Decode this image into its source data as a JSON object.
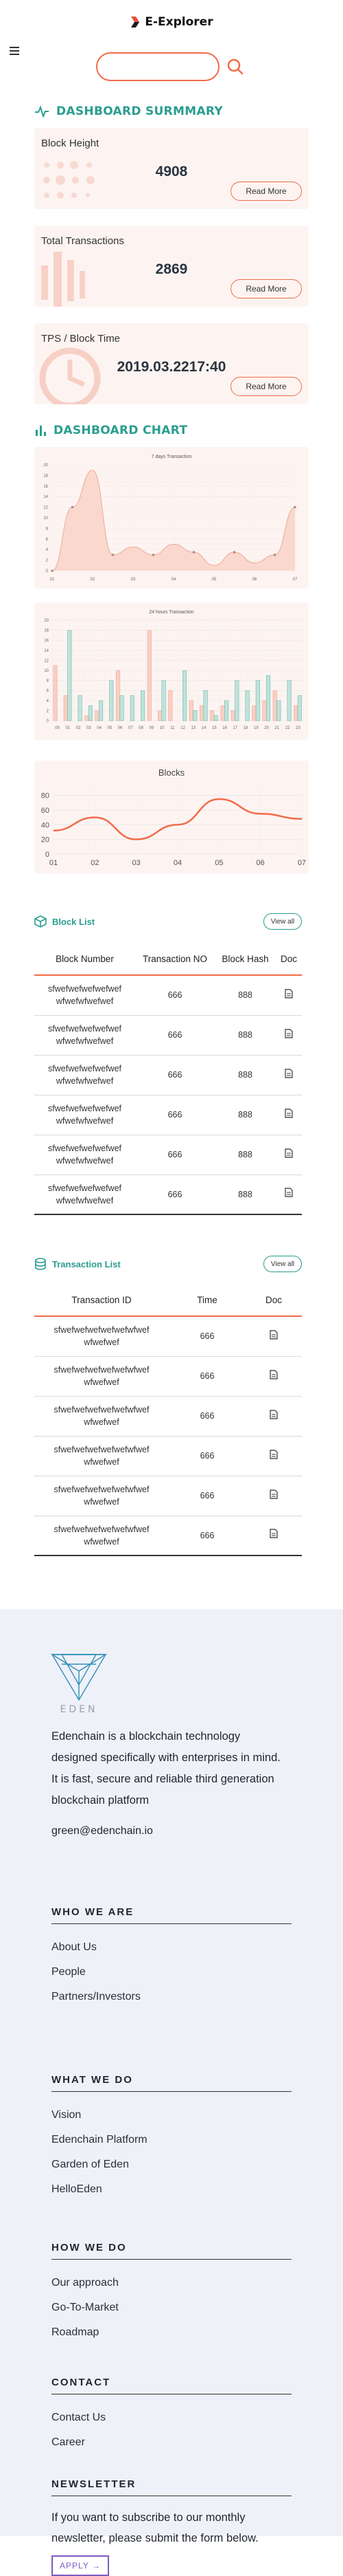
{
  "header": {
    "brand": "E-Explorer",
    "search_placeholder": ""
  },
  "summary": {
    "title": "DASHBOARD SURMMARY",
    "cards": [
      {
        "label": "Block Height",
        "value": "4908",
        "button": "Read More"
      },
      {
        "label": "Total Transactions",
        "value": "2869",
        "button": "Read More"
      },
      {
        "label": "TPS / Block Time",
        "value": "2019.03.2217:40",
        "button": "Read More"
      }
    ]
  },
  "charts_section": {
    "title": "DASHBOARD CHART"
  },
  "chart_data": [
    {
      "type": "area",
      "title": "7 days Transaction",
      "categories": [
        "01",
        "02",
        "03",
        "04",
        "05",
        "06",
        "07"
      ],
      "x": [
        0,
        1,
        2,
        3,
        4,
        5,
        6,
        7,
        8,
        9,
        10,
        11,
        12
      ],
      "values": [
        0,
        12,
        19,
        3,
        4.5,
        3,
        5,
        3.5,
        1,
        3.5,
        1.5,
        3,
        12
      ],
      "ylim": [
        0,
        20
      ],
      "yticks": [
        "0",
        "2",
        "4",
        "6",
        "8",
        "10",
        "12",
        "14",
        "16",
        "18",
        "20"
      ]
    },
    {
      "type": "bar",
      "title": "24 hours Transaction",
      "categories": [
        "00",
        "01",
        "02",
        "03",
        "04",
        "05",
        "06",
        "07",
        "08",
        "09",
        "10",
        "11",
        "12",
        "13",
        "14",
        "15",
        "16",
        "17",
        "18",
        "19",
        "20",
        "21",
        "22",
        "23"
      ],
      "series": [
        {
          "name": "",
          "values": [
            11,
            5,
            0,
            1,
            2,
            0,
            10,
            0,
            0,
            18,
            2,
            6,
            0,
            4,
            3,
            2,
            3,
            2,
            0,
            3,
            4,
            6,
            0,
            3
          ]
        },
        {
          "name": "",
          "values": [
            0,
            18,
            5,
            3,
            4,
            8,
            5,
            5,
            6,
            0,
            8,
            0,
            10,
            2,
            6,
            1,
            4,
            8,
            6,
            8,
            9,
            4,
            8,
            5
          ]
        }
      ],
      "ylim": [
        0,
        20
      ],
      "yticks": [
        "0",
        "2",
        "4",
        "6",
        "8",
        "10",
        "12",
        "14",
        "16",
        "18",
        "20"
      ]
    },
    {
      "type": "line",
      "title": "Blocks",
      "categories": [
        "01",
        "02",
        "03",
        "04",
        "05",
        "06",
        "07"
      ],
      "values": [
        32,
        50,
        20,
        40,
        75,
        55,
        48
      ],
      "ylim": [
        0,
        90
      ],
      "yticks": [
        "0",
        "20",
        "40",
        "60",
        "80"
      ]
    }
  ],
  "block_list": {
    "title": "Block List",
    "view_all": "View all",
    "columns": [
      "Block Number",
      "Transaction NO",
      "Block Hash",
      "Doc"
    ],
    "rows": [
      {
        "number_line1": "sfwefwefwefwefwef",
        "number_line2": "wfwefwfwefwef",
        "tx": "666",
        "hash": "888"
      },
      {
        "number_line1": "sfwefwefwefwefwef",
        "number_line2": "wfwefwfwefwef",
        "tx": "666",
        "hash": "888"
      },
      {
        "number_line1": "sfwefwefwefwefwef",
        "number_line2": "wfwefwfwefwef",
        "tx": "666",
        "hash": "888"
      },
      {
        "number_line1": "sfwefwefwefwefwef",
        "number_line2": "wfwefwfwefwef",
        "tx": "666",
        "hash": "888"
      },
      {
        "number_line1": "sfwefwefwefwefwef",
        "number_line2": "wfwefwfwefwef",
        "tx": "666",
        "hash": "888"
      },
      {
        "number_line1": "sfwefwefwefwefwef",
        "number_line2": "wfwefwfwefwef",
        "tx": "666",
        "hash": "888"
      }
    ]
  },
  "tx_list": {
    "title": "Transaction List",
    "view_all": "View all",
    "columns": [
      "Transaction ID",
      "Time",
      "Doc"
    ],
    "rows": [
      {
        "id_line1": "sfwefwefwefwefwefwfwef",
        "id_line2": "wfwefwef",
        "time": "666"
      },
      {
        "id_line1": "sfwefwefwefwefwefwfwef",
        "id_line2": "wfwefwef",
        "time": "666"
      },
      {
        "id_line1": "sfwefwefwefwefwefwfwef",
        "id_line2": "wfwefwef",
        "time": "666"
      },
      {
        "id_line1": "sfwefwefwefwefwefwfwef",
        "id_line2": "wfwefwef",
        "time": "666"
      },
      {
        "id_line1": "sfwefwefwefwefwefwfwef",
        "id_line2": "wfwefwef",
        "time": "666"
      },
      {
        "id_line1": "sfwefwefwefwefwefwfwef",
        "id_line2": "wfwefwef",
        "time": "666"
      }
    ]
  },
  "footer": {
    "logo_text": "EDEN",
    "about": "Edenchain is a blockchain technology designed specifically with enterprises in mind. It is fast, secure and reliable third generation blockchain platform",
    "email": "green@edenchain.io",
    "sections": [
      {
        "heading": "WHO WE ARE",
        "items": [
          "About Us",
          "People",
          "Partners/Investors"
        ]
      },
      {
        "heading": "WHAT WE DO",
        "items": [
          "Vision",
          "Edenchain Platform",
          "Garden of Eden",
          "HelloEden"
        ]
      },
      {
        "heading": "HOW WE DO",
        "items": [
          "Our approach",
          "Go-To-Market",
          "Roadmap"
        ]
      },
      {
        "heading": "CONTACT",
        "items": [
          "Contact Us",
          "Career"
        ]
      }
    ],
    "newsletter": {
      "heading": "NEWSLETTER",
      "text": "If you want to subscribe to our monthly newsletter, please submit the form below.",
      "button": "APPLY →"
    }
  },
  "colors": {
    "accent": "#f26b4a",
    "teal": "#2a9d8f",
    "card_bg": "#fdf4f1",
    "footer_bg": "#eff1f8"
  }
}
